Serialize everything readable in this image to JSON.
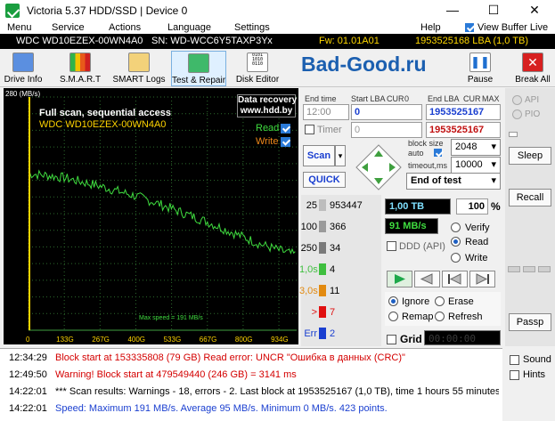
{
  "window": {
    "title": "Victoria 5.37 HDD/SSD | Device 0"
  },
  "menu": [
    "Menu",
    "Service",
    "Actions",
    "Language",
    "Settings",
    "Help"
  ],
  "menu_right": "View Buffer Live",
  "info": {
    "model": "WDC WD10EZEX-00WN4A0",
    "serial": "SN: WD-WCC6Y5TAXP3Y",
    "close": "x",
    "fw": "Fw: 01.01A01",
    "lba": "1953525168 LBA (1,0 TB)"
  },
  "toolbar": {
    "drive_info": "Drive Info",
    "smart": "S.M.A.R.T",
    "smart_logs": "SMART Logs",
    "test_repair": "Test & Repair",
    "disk_editor": "Disk Editor",
    "brand": "Bad-Good.ru",
    "pause": "Pause",
    "break_all": "Break All"
  },
  "graph": {
    "ymax_label": "280 (MB/s)",
    "title": "Full scan, sequential access",
    "model": "WDC WD10EZEX-00WN4A0",
    "promo1": "Data recovery",
    "promo2": "www.hdd.by",
    "read_label": "Read",
    "write_label": "Write",
    "max_speed": "Max speed = 191 MB/s",
    "x_ticks": [
      "0",
      "133G",
      "267G",
      "400G",
      "533G",
      "667G",
      "800G",
      "934G"
    ]
  },
  "chart_data": {
    "type": "line",
    "title": "Full scan, sequential access",
    "xlabel": "",
    "ylabel": "(MB/s)",
    "ylim": [
      0,
      280
    ],
    "x_ticks": [
      "0",
      "133G",
      "267G",
      "400G",
      "533G",
      "667G",
      "800G",
      "934G"
    ],
    "series": [
      {
        "name": "Read",
        "x": [
          0,
          67,
          133,
          200,
          267,
          333,
          400,
          467,
          533,
          600,
          667,
          733,
          800,
          867,
          934,
          1000
        ],
        "values": [
          188,
          186,
          183,
          178,
          173,
          167,
          161,
          154,
          146,
          138,
          130,
          121,
          112,
          103,
          96,
          90
        ]
      }
    ]
  },
  "controls": {
    "end_time_label": "End time",
    "start_lba_label": "Start LBA",
    "cur_label": "CUR",
    "zero_label": "0",
    "end_lba_label": "End LBA",
    "max_label": "MAX",
    "end_time": "12:00",
    "start_lba": "0",
    "end_lba": "1953525167",
    "timer_label": "Timer",
    "timer_value": "0",
    "end_lba_red": "1953525167",
    "scan": "Scan",
    "quick": "QUICK",
    "block_size_label": "block size",
    "auto_label": "auto",
    "timeout_label": "timeout,ms",
    "block_size": "2048",
    "timeout": "10000",
    "end_mode": "End of test"
  },
  "legend": [
    {
      "ms": "25",
      "count": "953447",
      "color": "#bdbdbd"
    },
    {
      "ms": "100",
      "count": "366",
      "color": "#9a9a9a"
    },
    {
      "ms": "250",
      "count": "34",
      "color": "#7a7a7a"
    },
    {
      "ms": "1,0s",
      "count": "4",
      "color": "#3fbf3f"
    },
    {
      "ms": "3,0s",
      "count": "11",
      "color": "#e28a10"
    },
    {
      "ms": ">",
      "count": "7",
      "color": "#e01010"
    },
    {
      "ms": "Err",
      "count": "2",
      "color": "#1a3fd0"
    }
  ],
  "status": {
    "progress": "1,00 TB",
    "percent": "100",
    "percent_sign": "%",
    "speed": "91 MB/s",
    "ddd": "DDD (API)",
    "verify": "Verify",
    "read": "Read",
    "write": "Write"
  },
  "actions": {
    "ignore": "Ignore",
    "erase": "Erase",
    "remap": "Remap",
    "refresh": "Refresh",
    "grid": "Grid",
    "grid_time": "00:00:00"
  },
  "side": {
    "api": "API",
    "pio": "PIO",
    "sleep": "Sleep",
    "recall": "Recall",
    "passp": "Passp"
  },
  "log": [
    {
      "time": "12:34:29",
      "msg": "Block start at 153335808 (79 GB) Read error: UNCR \"Ошибка в данных (CRC)\"",
      "color": "#d40000"
    },
    {
      "time": "12:49:50",
      "msg": "Warning! Block start at 479549440 (246 GB) = 3141 ms",
      "color": "#d40000"
    },
    {
      "time": "14:22:01",
      "msg": "*** Scan results: Warnings - 18, errors - 2. Last block at 1953525167 (1,0 TB), time 1 hours 55 minutes...",
      "color": "#000000"
    },
    {
      "time": "14:22:01",
      "msg": "Speed: Maximum 191 MB/s. Average 95 MB/s. Minimum 0 MB/s. 423 points.",
      "color": "#1a3fd0"
    }
  ],
  "log_side": {
    "sound": "Sound",
    "hints": "Hints"
  }
}
